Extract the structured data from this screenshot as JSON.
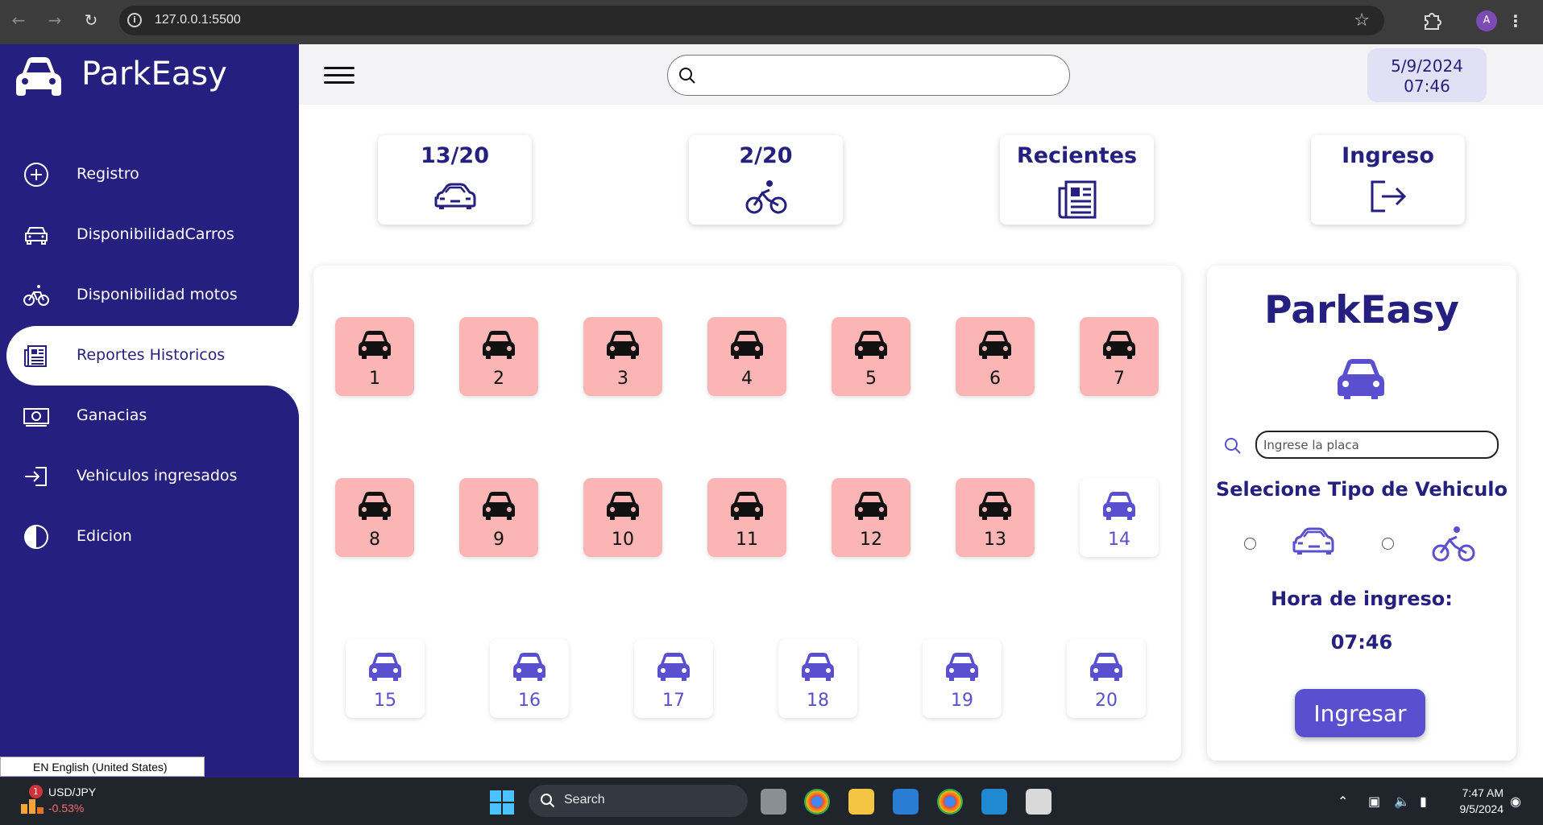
{
  "browser": {
    "url": "127.0.0.1:5500",
    "profile_initial": "A"
  },
  "sidebar": {
    "brand": "ParkEasy",
    "items": [
      {
        "label": "Registro",
        "icon": "plus-circle-icon"
      },
      {
        "label": "DisponibilidadCarros",
        "icon": "car-icon"
      },
      {
        "label": "Disponibilidad motos",
        "icon": "bicycle-icon"
      },
      {
        "label": "Reportes Historicos",
        "icon": "newspaper-icon",
        "active": true
      },
      {
        "label": "Ganacias",
        "icon": "money-icon"
      },
      {
        "label": "Vehiculos ingresados",
        "icon": "login-icon"
      },
      {
        "label": "Edicion",
        "icon": "contrast-icon"
      }
    ]
  },
  "topbar": {
    "search_placeholder": "",
    "date": "5/9/2024",
    "time": "07:46"
  },
  "stats": [
    {
      "title": "13/20",
      "icon": "car-icon"
    },
    {
      "title": "2/20",
      "icon": "bicycle-icon"
    },
    {
      "title": "Recientes",
      "icon": "newspaper-icon"
    },
    {
      "title": "Ingreso",
      "icon": "logout-icon"
    }
  ],
  "slots": [
    {
      "number": "1",
      "status": "occupied"
    },
    {
      "number": "2",
      "status": "occupied"
    },
    {
      "number": "3",
      "status": "occupied"
    },
    {
      "number": "4",
      "status": "occupied"
    },
    {
      "number": "5",
      "status": "occupied"
    },
    {
      "number": "6",
      "status": "occupied"
    },
    {
      "number": "7",
      "status": "occupied"
    },
    {
      "number": "8",
      "status": "occupied"
    },
    {
      "number": "9",
      "status": "occupied"
    },
    {
      "number": "10",
      "status": "occupied"
    },
    {
      "number": "11",
      "status": "occupied"
    },
    {
      "number": "12",
      "status": "occupied"
    },
    {
      "number": "13",
      "status": "occupied"
    },
    {
      "number": "14",
      "status": "free"
    },
    {
      "number": "15",
      "status": "free"
    },
    {
      "number": "16",
      "status": "free"
    },
    {
      "number": "17",
      "status": "free"
    },
    {
      "number": "18",
      "status": "free"
    },
    {
      "number": "19",
      "status": "free"
    },
    {
      "number": "20",
      "status": "free"
    }
  ],
  "form": {
    "title": "ParkEasy",
    "plate_placeholder": "Ingrese la placa",
    "vehicle_type_label": "Selecione Tipo de Vehiculo",
    "hour_label": "Hora de ingreso:",
    "hour_value": "07:46",
    "submit_label": "Ingresar"
  },
  "colors": {
    "primary": "#251f7f",
    "accent": "#5a4fcf",
    "occupied": "#fbb5b5"
  },
  "os": {
    "language_bar": "EN English (United States)",
    "ticker_name": "USD/JPY",
    "ticker_change": "-0.53%",
    "ticker_badge": "1",
    "search_label": "Search",
    "clock_time": "7:47 AM",
    "clock_date": "9/5/2024"
  }
}
